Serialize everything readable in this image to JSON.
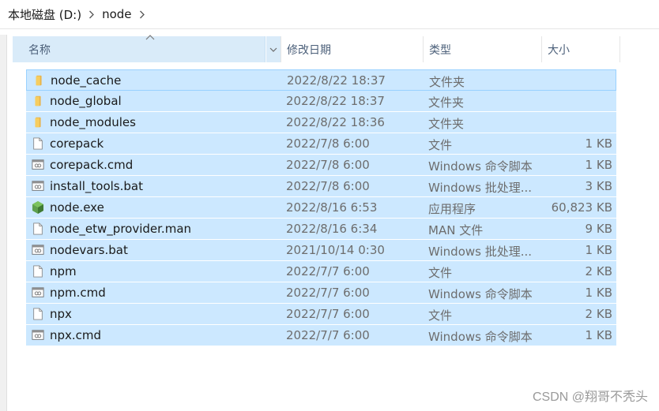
{
  "address": {
    "crumbs": [
      "本地磁盘 (D:)",
      "node"
    ]
  },
  "columns": {
    "name": "名称",
    "date": "修改日期",
    "type": "类型",
    "size": "大小"
  },
  "files": [
    {
      "name": "node_cache",
      "date": "2022/8/22 18:37",
      "type": "文件夹",
      "size": "",
      "icon": "folder-icon"
    },
    {
      "name": "node_global",
      "date": "2022/8/22 18:37",
      "type": "文件夹",
      "size": "",
      "icon": "folder-icon"
    },
    {
      "name": "node_modules",
      "date": "2022/8/22 18:36",
      "type": "文件夹",
      "size": "",
      "icon": "folder-icon"
    },
    {
      "name": "corepack",
      "date": "2022/7/8 6:00",
      "type": "文件",
      "size": "1 KB",
      "icon": "file-icon"
    },
    {
      "name": "corepack.cmd",
      "date": "2022/7/8 6:00",
      "type": "Windows 命令脚本",
      "size": "1 KB",
      "icon": "script-icon"
    },
    {
      "name": "install_tools.bat",
      "date": "2022/7/8 6:00",
      "type": "Windows 批处理...",
      "size": "3 KB",
      "icon": "script-icon"
    },
    {
      "name": "node.exe",
      "date": "2022/8/16 6:53",
      "type": "应用程序",
      "size": "60,823 KB",
      "icon": "nodejs-icon"
    },
    {
      "name": "node_etw_provider.man",
      "date": "2022/8/16 6:34",
      "type": "MAN 文件",
      "size": "9 KB",
      "icon": "file-icon"
    },
    {
      "name": "nodevars.bat",
      "date": "2021/10/14 0:30",
      "type": "Windows 批处理...",
      "size": "1 KB",
      "icon": "script-icon"
    },
    {
      "name": "npm",
      "date": "2022/7/7 6:00",
      "type": "文件",
      "size": "2 KB",
      "icon": "file-icon"
    },
    {
      "name": "npm.cmd",
      "date": "2022/7/7 6:00",
      "type": "Windows 命令脚本",
      "size": "1 KB",
      "icon": "script-icon"
    },
    {
      "name": "npx",
      "date": "2022/7/7 6:00",
      "type": "文件",
      "size": "2 KB",
      "icon": "file-icon"
    },
    {
      "name": "npx.cmd",
      "date": "2022/7/7 6:00",
      "type": "Windows 命令脚本",
      "size": "1 KB",
      "icon": "script-icon"
    }
  ],
  "watermark": "CSDN @翔哥不秃头",
  "colors": {
    "selection": "#cce8ff",
    "focus_border": "#99d1ff",
    "header_active": "#d9ebf9",
    "folder": "#f0c35a"
  }
}
